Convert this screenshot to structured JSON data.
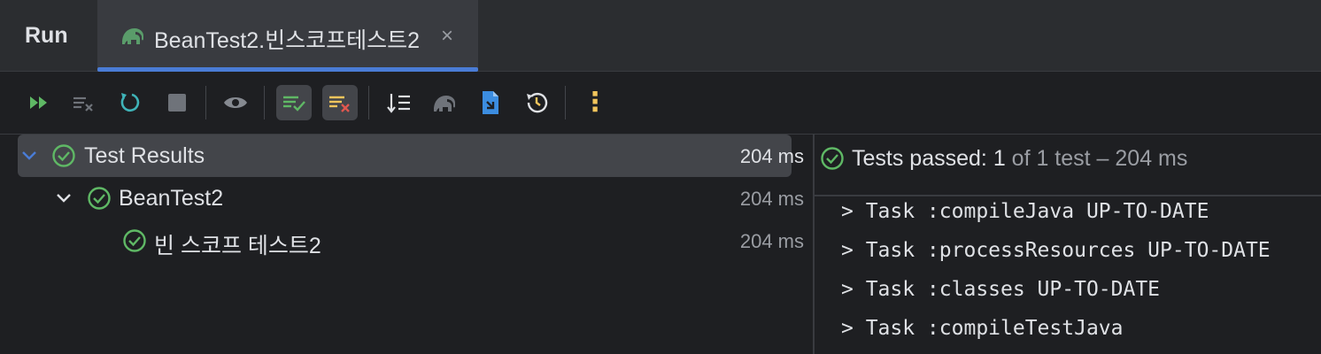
{
  "tabbar": {
    "run_label": "Run",
    "tab_title": "BeanTest2.빈스코프테스트2",
    "close_glyph": "×"
  },
  "toolbar": {
    "buttons": [
      "rerun-failed-icon",
      "stop-all-icon",
      "rerun-icon",
      "stop-icon",
      "show-ignored-icon",
      "show-passed-icon",
      "show-failed-icon",
      "sort-icon",
      "gradle-icon",
      "export-icon",
      "history-icon",
      "more-icon"
    ],
    "more_glyph": "⋮"
  },
  "tree": {
    "root": {
      "label": "Test Results",
      "time": "204 ms"
    },
    "class": {
      "label": "BeanTest2",
      "time": "204 ms"
    },
    "method": {
      "label": "빈 스코프 테스트2",
      "time": "204 ms"
    }
  },
  "status": {
    "prefix": "Tests passed: ",
    "count": "1",
    "suffix": " of 1 test – 204 ms"
  },
  "console": {
    "lines": [
      "> Task :compileJava UP-TO-DATE",
      "> Task :processResources UP-TO-DATE",
      "> Task :classes UP-TO-DATE",
      "> Task :compileTestJava"
    ]
  },
  "colors": {
    "accent": "#4a7cd6",
    "pass_green": "#5fb865",
    "warning_yellow": "#f2c55c",
    "background": "#1e1f22",
    "panel": "#2b2d30"
  }
}
